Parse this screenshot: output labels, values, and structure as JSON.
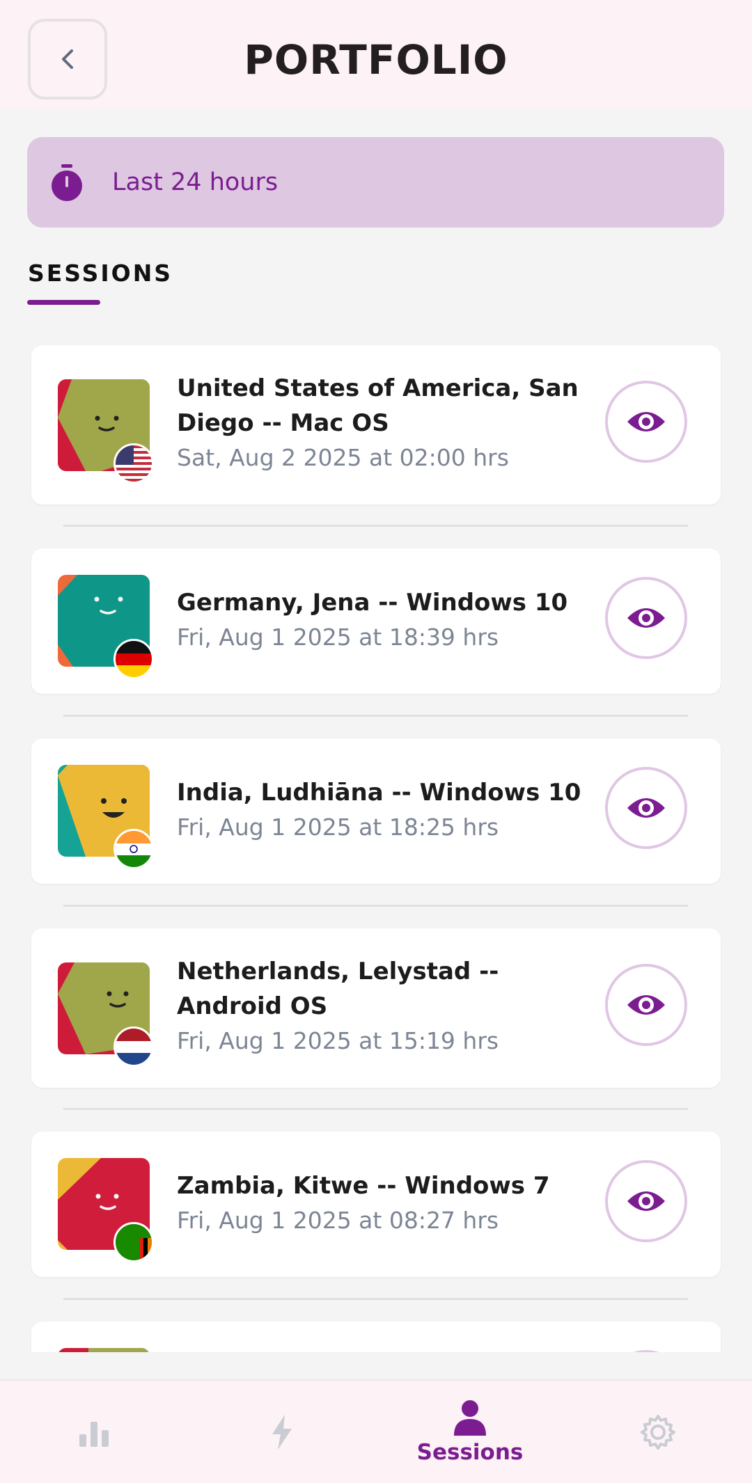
{
  "header": {
    "title": "PORTFOLIO"
  },
  "filter": {
    "label": "Last 24 hours",
    "icon": "stopwatch-icon"
  },
  "section": {
    "title": "SESSIONS"
  },
  "sessions": [
    {
      "location": "United States of America, San Diego -- Mac OS",
      "date": "Sat, Aug 2 2025 at 02:00 hrs",
      "flag": "us-flag-icon"
    },
    {
      "location": "Germany, Jena -- Windows 10",
      "date": "Fri, Aug 1 2025 at 18:39 hrs",
      "flag": "germany-flag-icon"
    },
    {
      "location": "India, Ludhiāna -- Windows 10",
      "date": "Fri, Aug 1 2025 at 18:25 hrs",
      "flag": "india-flag-icon"
    },
    {
      "location": "Netherlands, Lelystad -- Android OS",
      "date": "Fri, Aug 1 2025 at 15:19 hrs",
      "flag": "netherlands-flag-icon"
    },
    {
      "location": "Zambia, Kitwe -- Windows 7",
      "date": "Fri, Aug 1 2025 at 08:27 hrs",
      "flag": "zambia-flag-icon"
    }
  ],
  "bottom_nav": {
    "items": [
      {
        "icon": "bar-chart-icon",
        "label": ""
      },
      {
        "icon": "lightning-icon",
        "label": ""
      },
      {
        "icon": "user-icon",
        "label": "Sessions"
      },
      {
        "icon": "gear-icon",
        "label": ""
      }
    ]
  },
  "colors": {
    "accent": "#7b1d91",
    "header_bg": "#fdf2f5",
    "filter_bg": "#dec7e1"
  }
}
